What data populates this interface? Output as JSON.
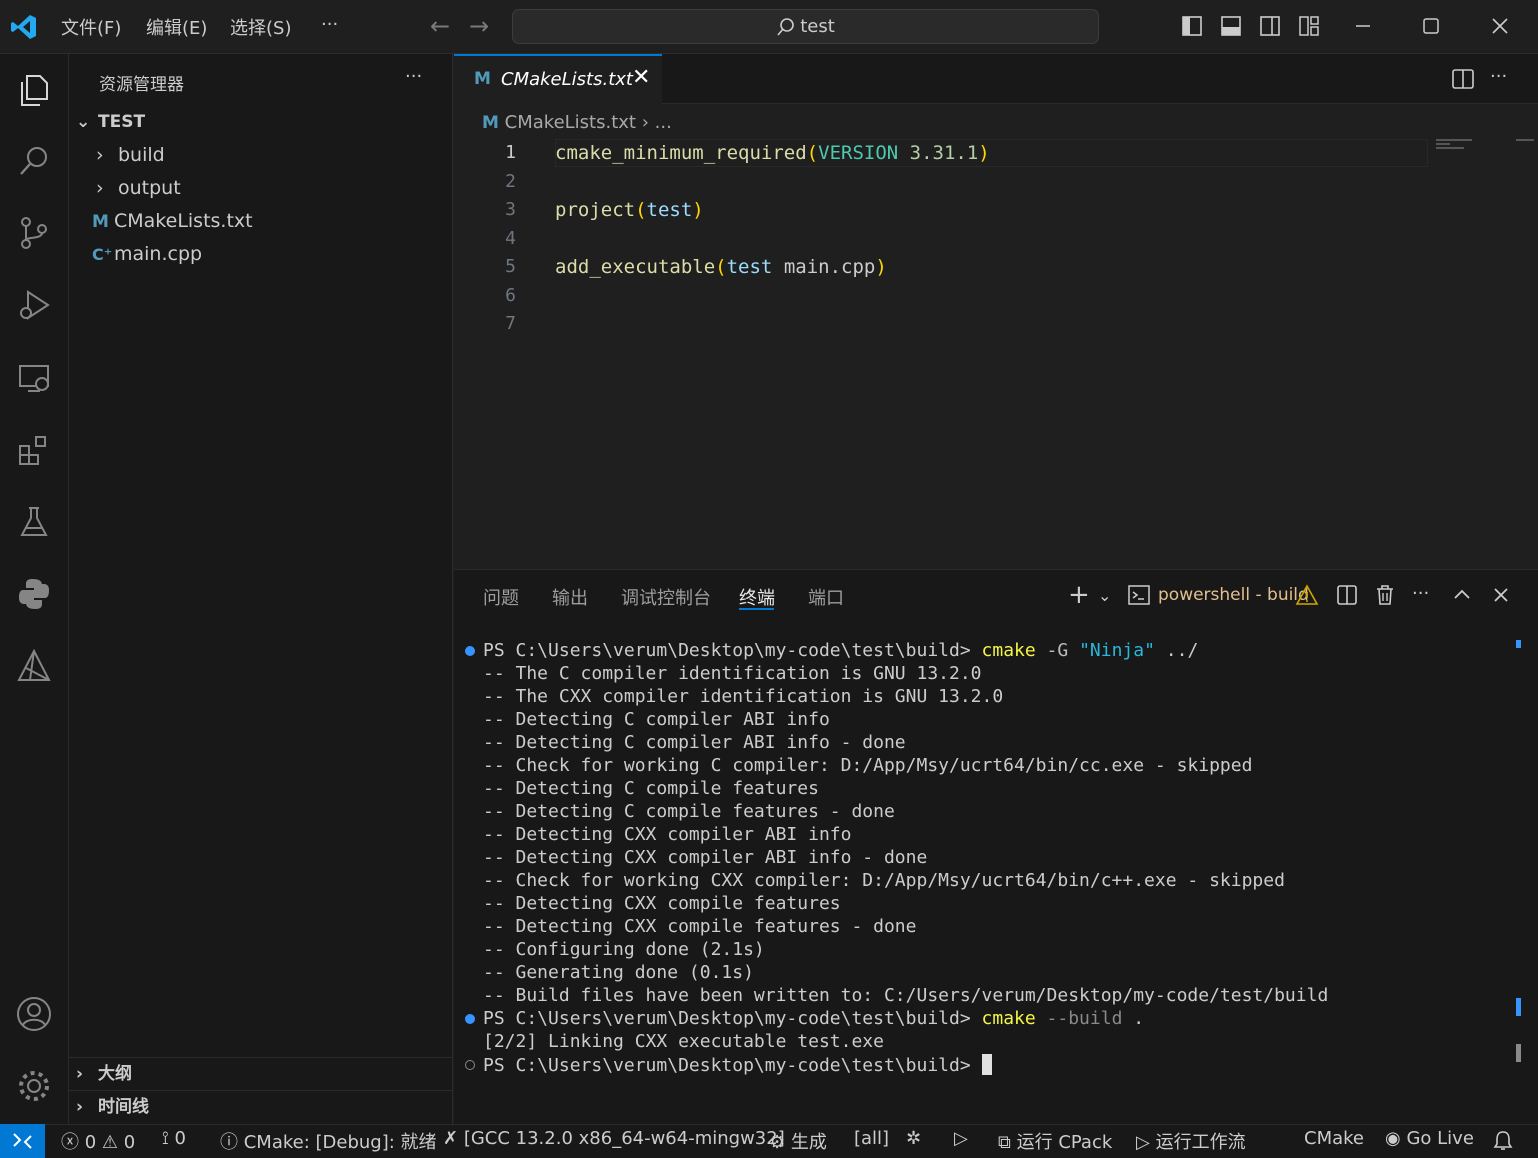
{
  "titlebar": {
    "menu": [
      "文件(F)",
      "编辑(E)",
      "选择(S)",
      "···"
    ],
    "search": "test"
  },
  "sidebar": {
    "title": "资源管理器",
    "more": "···",
    "root": "TEST",
    "items": [
      {
        "label": "build",
        "type": "folder"
      },
      {
        "label": "output",
        "type": "folder"
      },
      {
        "label": "CMakeLists.txt",
        "type": "cmake"
      },
      {
        "label": "main.cpp",
        "type": "cpp"
      }
    ],
    "outline": "大纲",
    "timeline": "时间线"
  },
  "editor": {
    "tab_label": "CMakeLists.txt",
    "breadcrumb_file": "CMakeLists.txt",
    "breadcrumb_more": "...",
    "line_numbers": [
      "1",
      "2",
      "3",
      "4",
      "5",
      "6",
      "7"
    ],
    "code": {
      "l1_fn": "cmake_minimum_required",
      "l1_arg": "VERSION",
      "l1_ver": "3.31.1",
      "l3_fn": "project",
      "l3_arg": "test",
      "l5_fn": "add_executable",
      "l5_arg1": "test",
      "l5_arg2": "main.cpp"
    }
  },
  "panel": {
    "tabs": [
      "问题",
      "输出",
      "调试控制台",
      "终端",
      "端口"
    ],
    "active_tab": "终端",
    "terminal_name": "powershell - build",
    "prompt": "PS C:\\Users\\verum\\Desktop\\my-code\\test\\build>",
    "cmd1": "cmake",
    "cmd1_flag": "-G",
    "cmd1_str": "\"Ninja\"",
    "cmd1_path": "../",
    "output": [
      "-- The C compiler identification is GNU 13.2.0",
      "-- The CXX compiler identification is GNU 13.2.0",
      "-- Detecting C compiler ABI info",
      "-- Detecting C compiler ABI info - done",
      "-- Check for working C compiler: D:/App/Msy/ucrt64/bin/cc.exe - skipped",
      "-- Detecting C compile features",
      "-- Detecting C compile features - done",
      "-- Detecting CXX compiler ABI info",
      "-- Detecting CXX compiler ABI info - done",
      "-- Check for working CXX compiler: D:/App/Msy/ucrt64/bin/c++.exe - skipped",
      "-- Detecting CXX compile features",
      "-- Detecting CXX compile features - done",
      "-- Configuring done (2.1s)",
      "-- Generating done (0.1s)",
      "-- Build files have been written to: C:/Users/verum/Desktop/my-code/test/build"
    ],
    "cmd2": "cmake",
    "cmd2_args": "--build",
    "cmd2_dot": ".",
    "link_line": "[2/2] Linking CXX executable test.exe"
  },
  "statusbar": {
    "errors": "0",
    "warnings": "0",
    "ports": "0",
    "cmake_status": "CMake: [Debug]: 就绪",
    "kit": "[GCC 13.2.0 x86_64-w64-mingw32]",
    "build": "生成",
    "target": "[all]",
    "cpack": "运行 CPack",
    "workflow": "运行工作流",
    "cmake": "CMake",
    "golive": "Go Live"
  },
  "colors": {
    "accent": "#0078d4",
    "fn": "#dcdcaa",
    "param": "#9cdcfe",
    "number": "#b5cea8",
    "string": "#ce9178",
    "paren": "#ffd700",
    "keyword": "#4ec9b0"
  }
}
